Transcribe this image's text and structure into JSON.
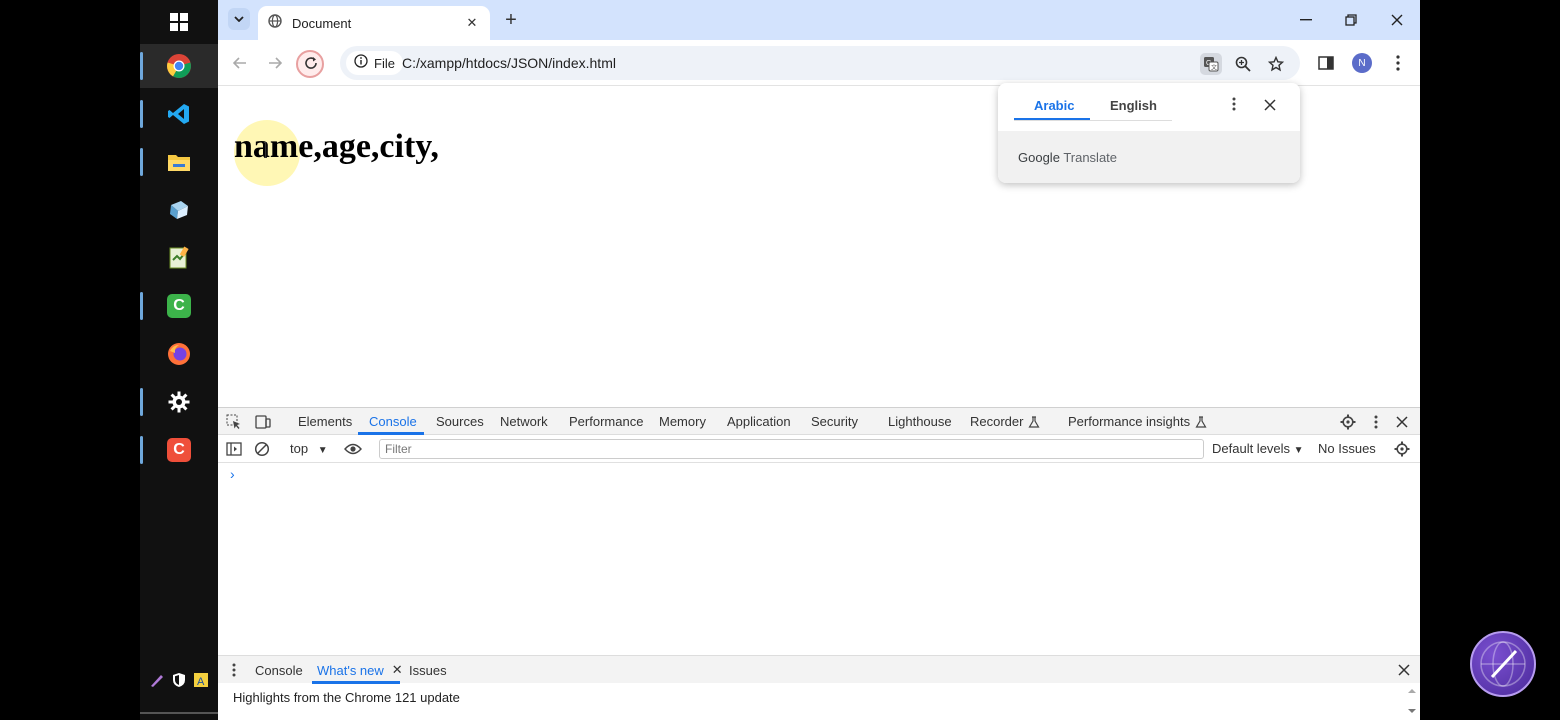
{
  "window": {
    "tab_title": "Document",
    "tab_close": "✕",
    "new_tab": "+"
  },
  "address_bar": {
    "site_chip": "File",
    "url": "C:/xampp/htdocs/JSON/index.html",
    "profile_initial": "N"
  },
  "page": {
    "content": "name,age,city,"
  },
  "translate_popup": {
    "source_language": "Arabic",
    "target_language": "English",
    "brand_google": "Google",
    "brand_translate": "Translate"
  },
  "devtools": {
    "tabs": [
      "Elements",
      "Console",
      "Sources",
      "Network",
      "Performance",
      "Memory",
      "Application",
      "Security",
      "Lighthouse",
      "Recorder",
      "Performance insights"
    ],
    "active_tab": "Console",
    "context": "top",
    "filter_placeholder": "Filter",
    "levels": "Default levels",
    "issues": "No Issues",
    "prompt": "›",
    "drawer_tabs": [
      "Console",
      "What's new",
      "Issues"
    ],
    "drawer_active": "What's new",
    "drawer_close": "✕",
    "whats_new_text": "Highlights from the Chrome 121 update"
  },
  "taskbar": {
    "apps": [
      "windows-start",
      "chrome",
      "vscode",
      "file-explorer",
      "app-cube",
      "app-notepad",
      "camtasia-green",
      "firefox",
      "settings",
      "camtasia-red"
    ]
  },
  "colors": {
    "accent": "#1a73e8",
    "tabstrip": "#d3e3fd",
    "highlight": "#fff078"
  }
}
